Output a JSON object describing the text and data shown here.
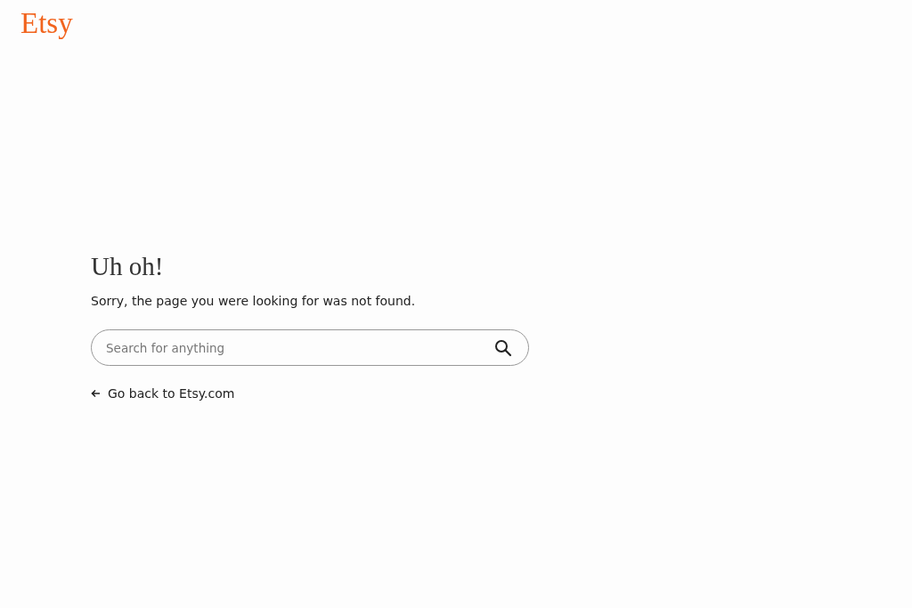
{
  "logo": "Etsy",
  "heading": "Uh oh!",
  "message": "Sorry, the page you were looking for was not found.",
  "search": {
    "placeholder": "Search for anything"
  },
  "back_link": "Go back to Etsy.com"
}
